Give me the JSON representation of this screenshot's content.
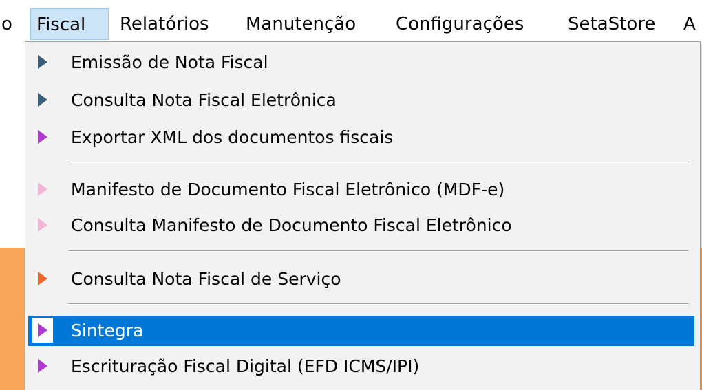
{
  "menubar": {
    "prev_partial": "o",
    "items": [
      {
        "label": "Fiscal",
        "active": true
      },
      {
        "label": "Relatórios"
      },
      {
        "label": "Manutenção"
      },
      {
        "label": "Configurações"
      },
      {
        "label": "SetaStore"
      }
    ],
    "next_partial": "A"
  },
  "dropdown": {
    "items": [
      {
        "label": "Emissão de Nota Fiscal",
        "icon": "arrow-right-icon",
        "icon_color": "#3a5f7a"
      },
      {
        "label": "Consulta Nota Fiscal Eletrônica",
        "icon": "arrow-right-icon",
        "icon_color": "#3a5f7a"
      },
      {
        "label": "Exportar XML dos documentos fiscais",
        "icon": "arrow-right-icon",
        "icon_color": "#b03ad0"
      },
      {
        "label": "Manifesto de Documento Fiscal Eletrônico (MDF-e)",
        "icon": "arrow-right-icon",
        "icon_color": "#f3b6d6"
      },
      {
        "label": "Consulta Manifesto de Documento Fiscal Eletrônico",
        "icon": "arrow-right-icon",
        "icon_color": "#f3b6d6"
      },
      {
        "label": "Consulta Nota Fiscal de Serviço",
        "icon": "arrow-right-icon",
        "icon_color": "#f0642a"
      },
      {
        "label": "Sintegra",
        "icon": "arrow-right-icon",
        "icon_color": "#b03ad0",
        "highlighted": true
      },
      {
        "label": "Escrituração Fiscal Digital (EFD ICMS/IPI)",
        "icon": "arrow-right-icon",
        "icon_color": "#b03ad0"
      }
    ]
  },
  "colors": {
    "highlight": "#0078d7",
    "menubar_active": "#cce4f7",
    "app_background": "#f7a65a"
  }
}
